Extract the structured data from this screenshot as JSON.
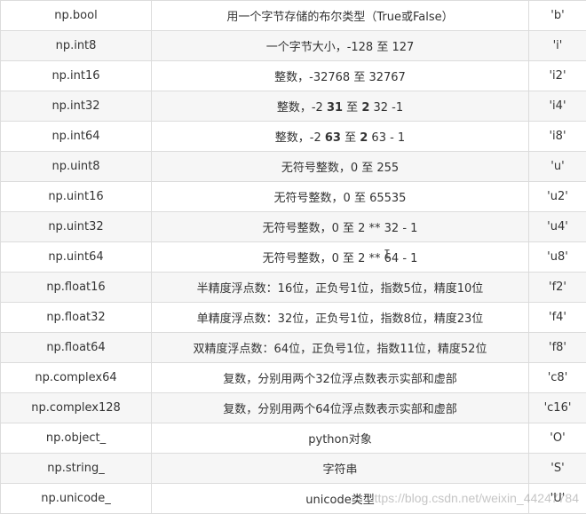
{
  "rows": [
    {
      "type": "np.bool",
      "desc": "用一个字节存储的布尔类型（True或False）",
      "code": "'b'"
    },
    {
      "type": "np.int8",
      "desc": "一个字节大小，-128 至 127",
      "code": "'i'"
    },
    {
      "type": "np.int16",
      "desc": "整数，-32768 至 32767",
      "code": "'i2'"
    },
    {
      "type": "np.int32",
      "desc_parts": [
        "整数，-2 ",
        "31",
        " 至 ",
        "2",
        " 32 -1"
      ],
      "code": "'i4'"
    },
    {
      "type": "np.int64",
      "desc_parts": [
        "整数，-2 ",
        "63",
        " 至 ",
        "2",
        " 63 - 1"
      ],
      "code": "'i8'"
    },
    {
      "type": "np.uint8",
      "desc": "无符号整数，0 至 255",
      "code": "'u'"
    },
    {
      "type": "np.uint16",
      "desc": "无符号整数，0 至 65535",
      "code": "'u2'"
    },
    {
      "type": "np.uint32",
      "desc": "无符号整数，0 至 2 ** 32 - 1",
      "code": "'u4'"
    },
    {
      "type": "np.uint64",
      "desc": "无符号整数，0 至 2 ** 64 - 1",
      "code": "'u8'"
    },
    {
      "type": "np.float16",
      "desc": "半精度浮点数：16位，正负号1位，指数5位，精度10位",
      "code": "'f2'"
    },
    {
      "type": "np.float32",
      "desc": "单精度浮点数：32位，正负号1位，指数8位，精度23位",
      "code": "'f4'"
    },
    {
      "type": "np.float64",
      "desc": "双精度浮点数：64位，正负号1位，指数11位，精度52位",
      "code": "'f8'"
    },
    {
      "type": "np.complex64",
      "desc": "复数，分别用两个32位浮点数表示实部和虚部",
      "code": "'c8'"
    },
    {
      "type": "np.complex128",
      "desc": "复数，分别用两个64位浮点数表示实部和虚部",
      "code": "'c16'"
    },
    {
      "type": "np.object_",
      "desc": "python对象",
      "code": "'O'"
    },
    {
      "type": "np.string_",
      "desc": "字符串",
      "code": "'S'"
    },
    {
      "type": "np.unicode_",
      "desc": "unicode类型",
      "code": "'U'"
    }
  ],
  "watermark": "https://blog.csdn.net/weixin_44247784",
  "cursor_glyph": "I"
}
